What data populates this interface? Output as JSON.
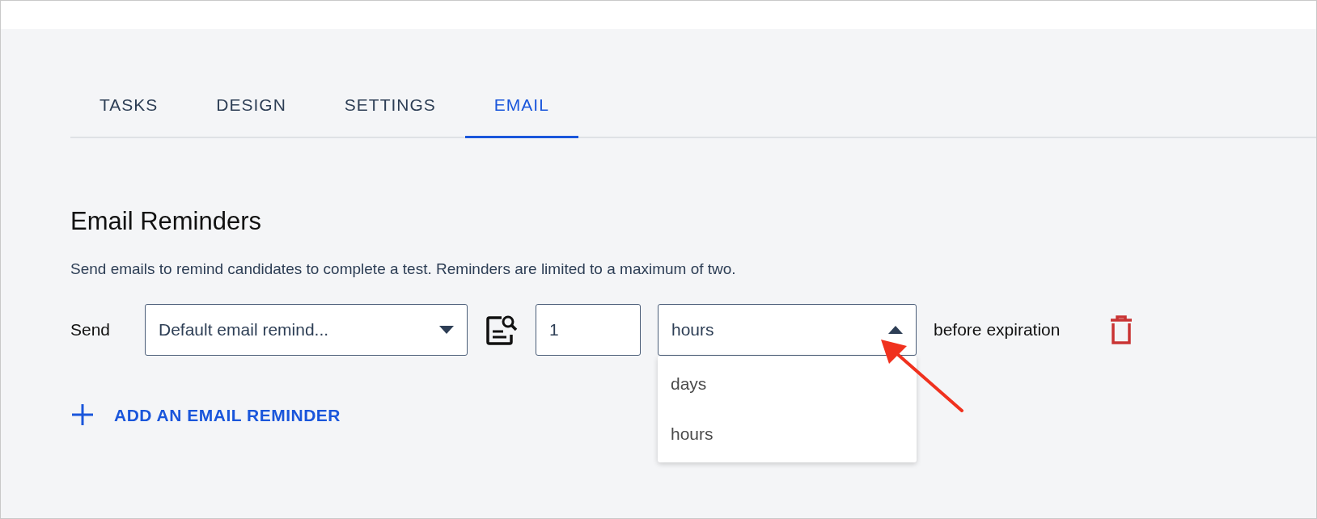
{
  "tabs": [
    {
      "label": "TASKS",
      "selected": false
    },
    {
      "label": "DESIGN",
      "selected": false
    },
    {
      "label": "SETTINGS",
      "selected": false
    },
    {
      "label": "EMAIL",
      "selected": true
    }
  ],
  "section": {
    "title": "Email Reminders",
    "description": "Send emails to remind candidates to complete a test. Reminders are limited to a maximum of two."
  },
  "reminders": [
    {
      "send_label": "Send",
      "template": {
        "value": "Default email remind...",
        "expanded": false
      },
      "amount": "1",
      "unit": {
        "value": "hours",
        "expanded": true,
        "options": [
          {
            "label": "days"
          },
          {
            "label": "hours"
          }
        ]
      },
      "suffix": "before expiration"
    }
  ],
  "add_link": "ADD AN EMAIL REMINDER"
}
